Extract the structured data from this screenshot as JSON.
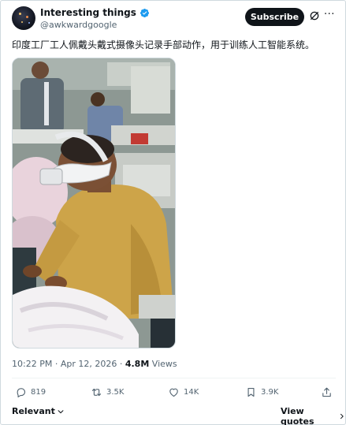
{
  "author": {
    "display_name": "Interesting things",
    "handle": "@awkwardgoogle",
    "verified": true,
    "badge_color": "#1d9bf0"
  },
  "header": {
    "subscribe_label": "Subscribe",
    "grok_icon": "grok-icon",
    "more_icon": "more-icon"
  },
  "post": {
    "text": "印度工厂工人佩戴头戴式摄像头记录手部动作，用于训练人工智能系统。",
    "media_type": "video",
    "time": "10:22 PM",
    "separator": "·",
    "date": "Apr 12, 2026",
    "views_count": "4.8M",
    "views_label": "Views"
  },
  "actions": {
    "replies": "819",
    "reposts": "3.5K",
    "likes": "14K",
    "bookmarks": "3.9K"
  },
  "footer": {
    "relevant_label": "Relevant",
    "view_quotes_label": "View quotes"
  },
  "colors": {
    "text_primary": "#0f1419",
    "text_secondary": "#536471",
    "border": "#cfd9de",
    "verified_blue": "#1d9bf0"
  }
}
